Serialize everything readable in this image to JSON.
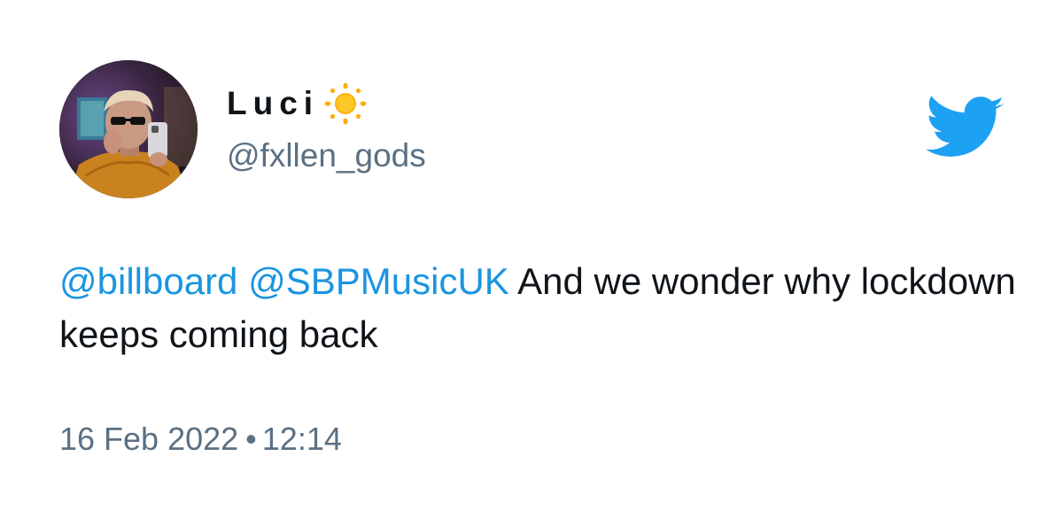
{
  "author": {
    "display_name": "Luci",
    "name_emoji": "sun-emoji",
    "handle": "@fxllen_gods",
    "avatar": "profile-photo"
  },
  "tweet": {
    "mentions": [
      "@billboard",
      "@SBPMusicUK"
    ],
    "text": "And we wonder why lockdown keeps coming back"
  },
  "meta": {
    "date": "16 Feb 2022",
    "separator": "•",
    "time": "12:14"
  },
  "brand": {
    "logo": "twitter-bird-icon",
    "accent_color": "#1da1f2",
    "mention_color": "#1b95e0",
    "secondary_text_color": "#5b7083"
  }
}
